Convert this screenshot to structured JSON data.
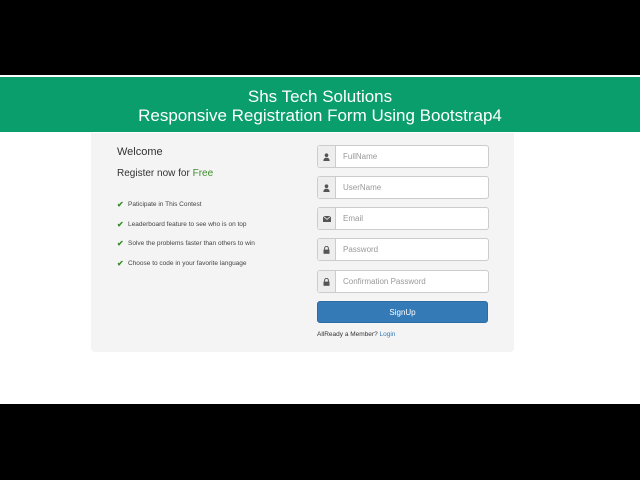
{
  "banner": {
    "line1": "Shs Tech Solutions",
    "line2": "Responsive Registration Form Using Bootstrap4"
  },
  "intro": {
    "welcome": "Welcome",
    "register_prefix": "Register now for ",
    "register_free": "Free"
  },
  "features": [
    "Paticipate in This Contest",
    "Leaderboard feature to see who is on top",
    "Solve the problems faster than others to win",
    "Choose to code in your favorite language"
  ],
  "form": {
    "fullname_placeholder": "FullName",
    "username_placeholder": "UserName",
    "email_placeholder": "Email",
    "password_placeholder": "Password",
    "confirm_placeholder": "Confirmation Password",
    "signup_label": "SignUp",
    "member_text": "AllReady a Member? ",
    "login_label": "Login"
  },
  "icons": {
    "fullname": "user-icon",
    "username": "user-icon",
    "email": "envelope-icon",
    "password": "lock-icon",
    "confirm": "lock-icon",
    "check": "check-icon"
  },
  "colors": {
    "banner": "#0b9e6d",
    "free": "#3c8c2e",
    "button": "#337ab7"
  }
}
